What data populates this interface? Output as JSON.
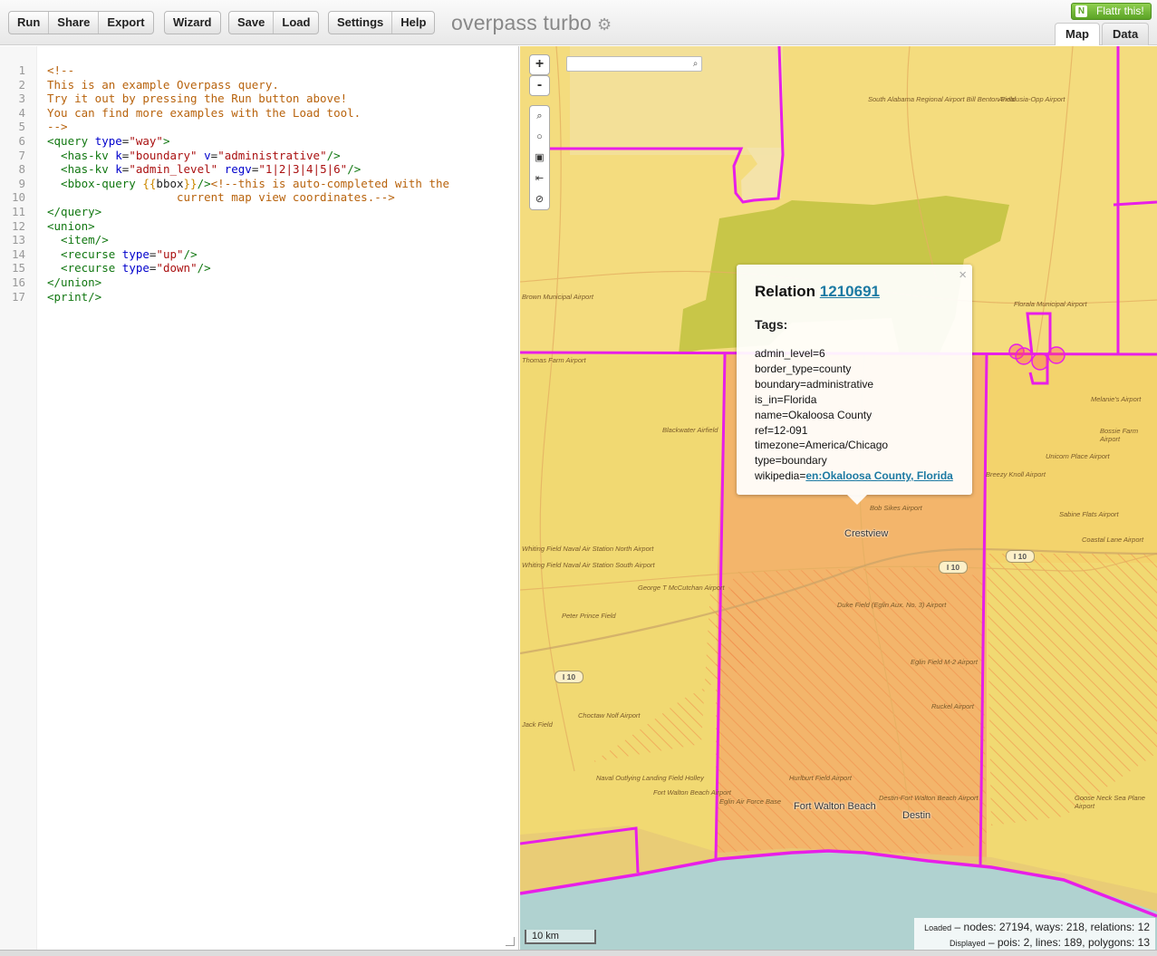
{
  "toolbar": {
    "groups": [
      [
        "Run",
        "Share",
        "Export"
      ],
      [
        "Wizard"
      ],
      [
        "Save",
        "Load"
      ],
      [
        "Settings",
        "Help"
      ]
    ],
    "logo": "overpass turbo",
    "flattr": "Flattr this!"
  },
  "tabs": {
    "map": "Map",
    "data": "Data"
  },
  "editor": {
    "line_numbers": [
      "1",
      "2",
      "3",
      "4",
      "5",
      "6",
      "7",
      "8",
      "9",
      "10",
      "11",
      "12",
      "13",
      "14",
      "15",
      "16",
      "17"
    ],
    "lines": [
      [
        {
          "t": "<!--",
          "c": "com"
        }
      ],
      [
        {
          "t": "This is an example Overpass query.",
          "c": "com"
        }
      ],
      [
        {
          "t": "Try it out by pressing the Run button above!",
          "c": "com"
        }
      ],
      [
        {
          "t": "You can find more examples with the Load tool.",
          "c": "com"
        }
      ],
      [
        {
          "t": "-->",
          "c": "com"
        }
      ],
      [
        {
          "t": "<query ",
          "c": "tag"
        },
        {
          "t": "type",
          "c": "att"
        },
        {
          "t": "=",
          "c": ""
        },
        {
          "t": "\"way\"",
          "c": "str"
        },
        {
          "t": ">",
          "c": "tag"
        }
      ],
      [
        {
          "t": "  <has-kv ",
          "c": "tag"
        },
        {
          "t": "k",
          "c": "att"
        },
        {
          "t": "=",
          "c": ""
        },
        {
          "t": "\"boundary\"",
          "c": "str"
        },
        {
          "t": " ",
          "c": ""
        },
        {
          "t": "v",
          "c": "att"
        },
        {
          "t": "=",
          "c": ""
        },
        {
          "t": "\"administrative\"",
          "c": "str"
        },
        {
          "t": "/>",
          "c": "tag"
        }
      ],
      [
        {
          "t": "  <has-kv ",
          "c": "tag"
        },
        {
          "t": "k",
          "c": "att"
        },
        {
          "t": "=",
          "c": ""
        },
        {
          "t": "\"admin_level\"",
          "c": "str"
        },
        {
          "t": " ",
          "c": ""
        },
        {
          "t": "regv",
          "c": "att"
        },
        {
          "t": "=",
          "c": ""
        },
        {
          "t": "\"1|2|3|4|5|6\"",
          "c": "str"
        },
        {
          "t": "/>",
          "c": "tag"
        }
      ],
      [
        {
          "t": "  <bbox-query ",
          "c": "tag"
        },
        {
          "t": "{{",
          "c": "br"
        },
        {
          "t": "bbox",
          "c": ""
        },
        {
          "t": "}}",
          "c": "br"
        },
        {
          "t": "/>",
          "c": "tag"
        },
        {
          "t": "<!--this is auto-completed with the",
          "c": "com"
        }
      ],
      [
        {
          "t": "                   current map view coordinates.-->",
          "c": "com"
        }
      ],
      [
        {
          "t": "</query>",
          "c": "tag"
        }
      ],
      [
        {
          "t": "<union>",
          "c": "tag"
        }
      ],
      [
        {
          "t": "  <item/>",
          "c": "tag"
        }
      ],
      [
        {
          "t": "  <recurse ",
          "c": "tag"
        },
        {
          "t": "type",
          "c": "att"
        },
        {
          "t": "=",
          "c": ""
        },
        {
          "t": "\"up\"",
          "c": "str"
        },
        {
          "t": "/>",
          "c": "tag"
        }
      ],
      [
        {
          "t": "  <recurse ",
          "c": "tag"
        },
        {
          "t": "type",
          "c": "att"
        },
        {
          "t": "=",
          "c": ""
        },
        {
          "t": "\"down\"",
          "c": "str"
        },
        {
          "t": "/>",
          "c": "tag"
        }
      ],
      [
        {
          "t": "</union>",
          "c": "tag"
        }
      ],
      [
        {
          "t": "<print/>",
          "c": "tag"
        }
      ]
    ]
  },
  "map": {
    "zoom_in": "+",
    "zoom_out": "-",
    "controls": [
      "search",
      "locate",
      "map-overlay",
      "fit-bounds",
      "reset"
    ],
    "search_placeholder": "",
    "labels": {
      "crestview": "Crestview",
      "fort_walton": "Fort Walton Beach",
      "destin": "Destin"
    },
    "small_labels": [
      "South Alabama Regional Airport Bill Benton Field",
      "Andalusia-Opp Airport",
      "Florala Municipal Airport",
      "Blackwater Airfield",
      "Bob Sikes Airport",
      "Whiting Field Naval Air Station North Airport",
      "Whiting Field Naval Air Station South Airport",
      "Peter Prince Field",
      "Choctaw Nolf Airport",
      "Duke Field (Eglin Aux. No. 3) Airport",
      "Eglin Field M-2 Airport",
      "Ruckel Airport",
      "Fort Walton Beach Airport",
      "Destin-Fort Walton Beach Airport",
      "Hurlburt Field Airport",
      "Naval Outlying Landing Field Holley",
      "Eglin Air Force Base",
      "Unicorn Place Airport",
      "Bossie Farm Airport",
      "Sabine Flats Airport",
      "Coastal Lane Airport",
      "Thomas Farm Airport",
      "Melanie's Airport",
      "George T McCutchan Airport",
      "Brown Municipal Airport",
      "Breezy Knoll Airport",
      "Goose Neck Sea Plane Airport",
      "Jack Field"
    ],
    "highways": [
      "I 10",
      "I 10",
      "I 10"
    ],
    "scale": "10 km",
    "stats": {
      "loaded_label": "Loaded",
      "loaded_text": "– nodes: 27194, ways: 218, relations: 12",
      "displayed_label": "Displayed",
      "displayed_text": "– pois: 2, lines: 189, polygons: 13"
    }
  },
  "popup": {
    "title_prefix": "Relation",
    "relation_id": "1210691",
    "tags_label": "Tags:",
    "tags": [
      "admin_level=6",
      "border_type=county",
      "boundary=administrative",
      "is_in=Florida",
      "name=Okaloosa County",
      "ref=12-091",
      "timezone=America/Chicago",
      "type=boundary"
    ],
    "wikipedia_key": "wikipedia=",
    "wikipedia_value": "en:Okaloosa County, Florida",
    "close": "×"
  },
  "colors": {
    "boundary": "#e81ee8",
    "county_fill": "#f3a86a",
    "base": "#f1d972",
    "water": "#b0d2d0"
  }
}
